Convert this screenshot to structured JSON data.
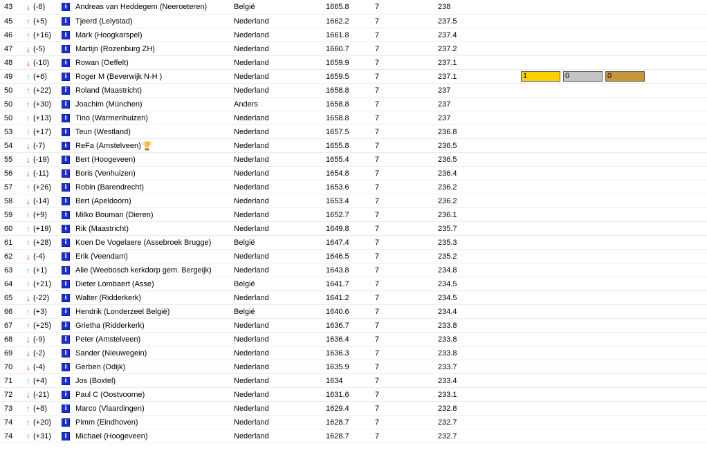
{
  "colors": {
    "up_arrow": "#2fcf2f",
    "down_arrow": "#e01010",
    "player_icon": "#1c2fd6",
    "trophy": "#d6b200",
    "medal_gold": "#ffd000",
    "medal_silver": "#c4c4c4",
    "medal_bronze": "#c8963a"
  },
  "icons": {
    "up": "arrow-up-icon",
    "down": "arrow-down-icon",
    "player": "player-profile-icon",
    "trophy": "trophy-icon"
  },
  "rows": [
    {
      "rank": "43",
      "dir": "down",
      "change": "(-8)",
      "name": "Andreas van Heddegem (Neeroeteren)",
      "country": "België",
      "points": "1665.8",
      "games": "7",
      "avg": "238"
    },
    {
      "rank": "45",
      "dir": "up",
      "change": "(+5)",
      "name": "Tjeerd (Lelystad)",
      "country": "Nederland",
      "points": "1662.2",
      "games": "7",
      "avg": "237.5"
    },
    {
      "rank": "46",
      "dir": "up",
      "change": "(+16)",
      "name": "Mark (Hoogkarspel)",
      "country": "Nederland",
      "points": "1661.8",
      "games": "7",
      "avg": "237.4"
    },
    {
      "rank": "47",
      "dir": "down",
      "change": "(-5)",
      "name": "Martijn (Rozenburg ZH)",
      "country": "Nederland",
      "points": "1660.7",
      "games": "7",
      "avg": "237.2"
    },
    {
      "rank": "48",
      "dir": "down",
      "change": "(-10)",
      "name": "Rowan (Oeffelt)",
      "country": "Nederland",
      "points": "1659.9",
      "games": "7",
      "avg": "237.1"
    },
    {
      "rank": "49",
      "dir": "up",
      "change": "(+6)",
      "name": "Roger M (Beverwijk N-H )",
      "country": "Nederland",
      "points": "1659.5",
      "games": "7",
      "avg": "237.1",
      "medals": {
        "gold": "1",
        "silver": "0",
        "bronze": "0"
      }
    },
    {
      "rank": "50",
      "dir": "up",
      "change": "(+22)",
      "name": "Roland (Maastricht)",
      "country": "Nederland",
      "points": "1658.8",
      "games": "7",
      "avg": "237"
    },
    {
      "rank": "50",
      "dir": "up",
      "change": "(+30)",
      "name": "Joachim (München)",
      "country": "Anders",
      "points": "1658.8",
      "games": "7",
      "avg": "237"
    },
    {
      "rank": "50",
      "dir": "up",
      "change": "(+13)",
      "name": "Tino (Warmenhuizen)",
      "country": "Nederland",
      "points": "1658.8",
      "games": "7",
      "avg": "237"
    },
    {
      "rank": "53",
      "dir": "up",
      "change": "(+17)",
      "name": "Teun (Westland)",
      "country": "Nederland",
      "points": "1657.5",
      "games": "7",
      "avg": "236.8"
    },
    {
      "rank": "54",
      "dir": "down",
      "change": "(-7)",
      "name": "ReFa (Amstelveen)",
      "country": "Nederland",
      "points": "1655.8",
      "games": "7",
      "avg": "236.5",
      "trophy": true
    },
    {
      "rank": "55",
      "dir": "down",
      "change": "(-19)",
      "name": "Bert (Hoogeveen)",
      "country": "Nederland",
      "points": "1655.4",
      "games": "7",
      "avg": "236.5"
    },
    {
      "rank": "56",
      "dir": "down",
      "change": "(-11)",
      "name": "Boris (Venhuizen)",
      "country": "Nederland",
      "points": "1654.8",
      "games": "7",
      "avg": "236.4"
    },
    {
      "rank": "57",
      "dir": "up",
      "change": "(+26)",
      "name": "Robin (Barendrecht)",
      "country": "Nederland",
      "points": "1653.6",
      "games": "7",
      "avg": "236.2"
    },
    {
      "rank": "58",
      "dir": "down",
      "change": "(-14)",
      "name": "Bert (Apeldoorn)",
      "country": "Nederland",
      "points": "1653.4",
      "games": "7",
      "avg": "236.2"
    },
    {
      "rank": "59",
      "dir": "up",
      "change": "(+9)",
      "name": "Milko Bouman (Dieren)",
      "country": "Nederland",
      "points": "1652.7",
      "games": "7",
      "avg": "236.1"
    },
    {
      "rank": "60",
      "dir": "up",
      "change": "(+19)",
      "name": "Rik (Maastricht)",
      "country": "Nederland",
      "points": "1649.8",
      "games": "7",
      "avg": "235.7"
    },
    {
      "rank": "61",
      "dir": "up",
      "change": "(+28)",
      "name": "Koen De Vogelaere (Assebroek Brugge)",
      "country": "België",
      "points": "1647.4",
      "games": "7",
      "avg": "235.3"
    },
    {
      "rank": "62",
      "dir": "down",
      "change": "(-4)",
      "name": "Erik (Veendam)",
      "country": "Nederland",
      "points": "1646.5",
      "games": "7",
      "avg": "235.2"
    },
    {
      "rank": "63",
      "dir": "up",
      "change": "(+1)",
      "name": "Alie (Weebosch kerkdorp gem. Bergeijk)",
      "country": "Nederland",
      "points": "1643.8",
      "games": "7",
      "avg": "234.8"
    },
    {
      "rank": "64",
      "dir": "up",
      "change": "(+21)",
      "name": "Dieter Lombaert (Asse)",
      "country": "België",
      "points": "1641.7",
      "games": "7",
      "avg": "234.5"
    },
    {
      "rank": "65",
      "dir": "down",
      "change": "(-22)",
      "name": "Walter (Ridderkerk)",
      "country": "Nederland",
      "points": "1641.2",
      "games": "7",
      "avg": "234.5"
    },
    {
      "rank": "66",
      "dir": "up",
      "change": "(+3)",
      "name": "Hendrik (Londerzeel België)",
      "country": "België",
      "points": "1640.6",
      "games": "7",
      "avg": "234.4"
    },
    {
      "rank": "67",
      "dir": "up",
      "change": "(+25)",
      "name": "Grietha (Ridderkerk)",
      "country": "Nederland",
      "points": "1636.7",
      "games": "7",
      "avg": "233.8"
    },
    {
      "rank": "68",
      "dir": "down",
      "change": "(-9)",
      "name": "Peter (Amstelveen)",
      "country": "Nederland",
      "points": "1636.4",
      "games": "7",
      "avg": "233.8"
    },
    {
      "rank": "69",
      "dir": "down",
      "change": "(-2)",
      "name": "Sander (Nieuwegein)",
      "country": "Nederland",
      "points": "1636.3",
      "games": "7",
      "avg": "233.8"
    },
    {
      "rank": "70",
      "dir": "down",
      "change": "(-4)",
      "name": "Gerben (Odijk)",
      "country": "Nederland",
      "points": "1635.9",
      "games": "7",
      "avg": "233.7"
    },
    {
      "rank": "71",
      "dir": "up",
      "change": "(+4)",
      "name": "Jos (Boxtel)",
      "country": "Nederland",
      "points": "1634",
      "games": "7",
      "avg": "233.4"
    },
    {
      "rank": "72",
      "dir": "down",
      "change": "(-21)",
      "name": "Paul C (Oostvoorne)",
      "country": "Nederland",
      "points": "1631.6",
      "games": "7",
      "avg": "233.1"
    },
    {
      "rank": "73",
      "dir": "up",
      "change": "(+8)",
      "name": "Marco (Vlaardingen)",
      "country": "Nederland",
      "points": "1629.4",
      "games": "7",
      "avg": "232.8"
    },
    {
      "rank": "74",
      "dir": "up",
      "change": "(+20)",
      "name": "Pimm (Eindhoven)",
      "country": "Nederland",
      "points": "1628.7",
      "games": "7",
      "avg": "232.7"
    },
    {
      "rank": "74",
      "dir": "up",
      "change": "(+31)",
      "name": "Michael (Hoogeveen)",
      "country": "Nederland",
      "points": "1628.7",
      "games": "7",
      "avg": "232.7"
    }
  ]
}
